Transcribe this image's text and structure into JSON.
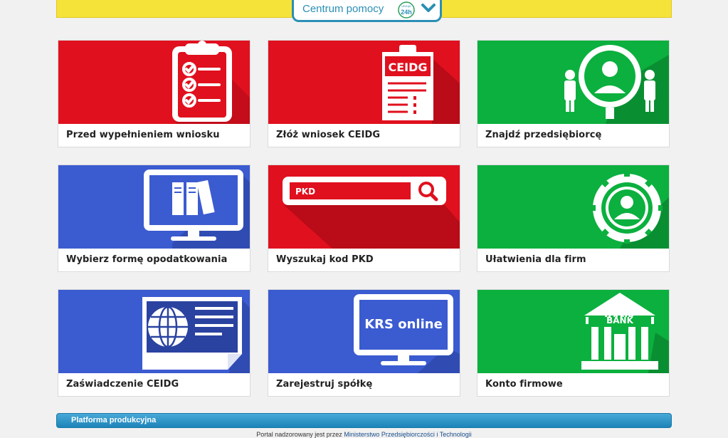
{
  "header": {
    "help_label": "Centrum pomocy",
    "badge_top": "URZĄD",
    "badge_main": "24h"
  },
  "tiles": [
    {
      "label": "Przed wypełnieniem wniosku",
      "color": "#e0101e",
      "icon": "clipboard-checklist-icon"
    },
    {
      "label": "Złóż wniosek CEIDG",
      "color": "#e0101e",
      "icon": "ceidg-form-icon",
      "icon_text": "CEIDG"
    },
    {
      "label": "Znajdź przedsiębiorcę",
      "color": "#0bb03e",
      "icon": "magnifier-person-icon"
    },
    {
      "label": "Wybierz formę opodatkowania",
      "color": "#3b5bd0",
      "icon": "monitor-binders-icon"
    },
    {
      "label": "Wyszukaj kod PKD",
      "color": "#e0101e",
      "icon": "search-bar-icon",
      "icon_text": "PKD"
    },
    {
      "label": "Ułatwienia dla firm",
      "color": "#0bb03e",
      "icon": "gear-person-icon"
    },
    {
      "label": "Zaświadczenie CEIDG",
      "color": "#3b5bd0",
      "icon": "globe-document-icon"
    },
    {
      "label": "Zarejestruj spółkę",
      "color": "#3b5bd0",
      "icon": "monitor-krs-icon",
      "icon_text": "KRS online"
    },
    {
      "label": "Konto firmowe",
      "color": "#0bb03e",
      "icon": "bank-building-icon",
      "icon_text": "BANK"
    }
  ],
  "platform_label": "Platforma produkcyjna",
  "footer": {
    "prefix": "Portal nadzorowany jest przez",
    "link": "Ministerstwo Przedsiębiorczości i Technologii"
  }
}
